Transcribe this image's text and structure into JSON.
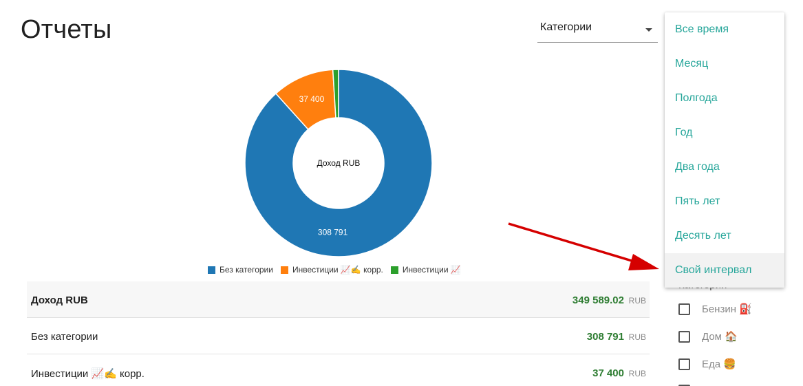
{
  "page": {
    "title": "Отчеты"
  },
  "category_select": {
    "value": "Категории"
  },
  "chart_data": {
    "type": "pie",
    "title": "Доход RUB",
    "categories": [
      "Без категории",
      "Инвестиции 📈✍️ корр.",
      "Инвестиции 📈"
    ],
    "values": [
      308791,
      37400,
      3398.02
    ],
    "value_labels": [
      "308 791",
      "37 400",
      ""
    ],
    "colors": [
      "#1f77b4",
      "#ff7f0e",
      "#2ca02c"
    ],
    "center_label": "Доход RUB",
    "legend_position": "bottom"
  },
  "table": {
    "rows": [
      {
        "label": "Доход RUB",
        "amount": "349 589.02",
        "currency": "RUB"
      },
      {
        "label": "Без категории",
        "amount": "308 791",
        "currency": "RUB"
      },
      {
        "label": "Инвестиции 📈✍️ корр.",
        "amount": "37 400",
        "currency": "RUB"
      }
    ]
  },
  "period_menu": {
    "items": [
      "Все время",
      "Месяц",
      "Полгода",
      "Год",
      "Два года",
      "Пять лет",
      "Десять лет",
      "Свой интервал"
    ],
    "highlighted": "Свой интервал",
    "color": "#26a69a"
  },
  "filters": {
    "title": "Категории",
    "items": [
      "Бензин ⛽",
      "Дом 🏠",
      "Еда 🍔"
    ]
  },
  "annotation": {
    "arrow_color": "#d50000"
  }
}
